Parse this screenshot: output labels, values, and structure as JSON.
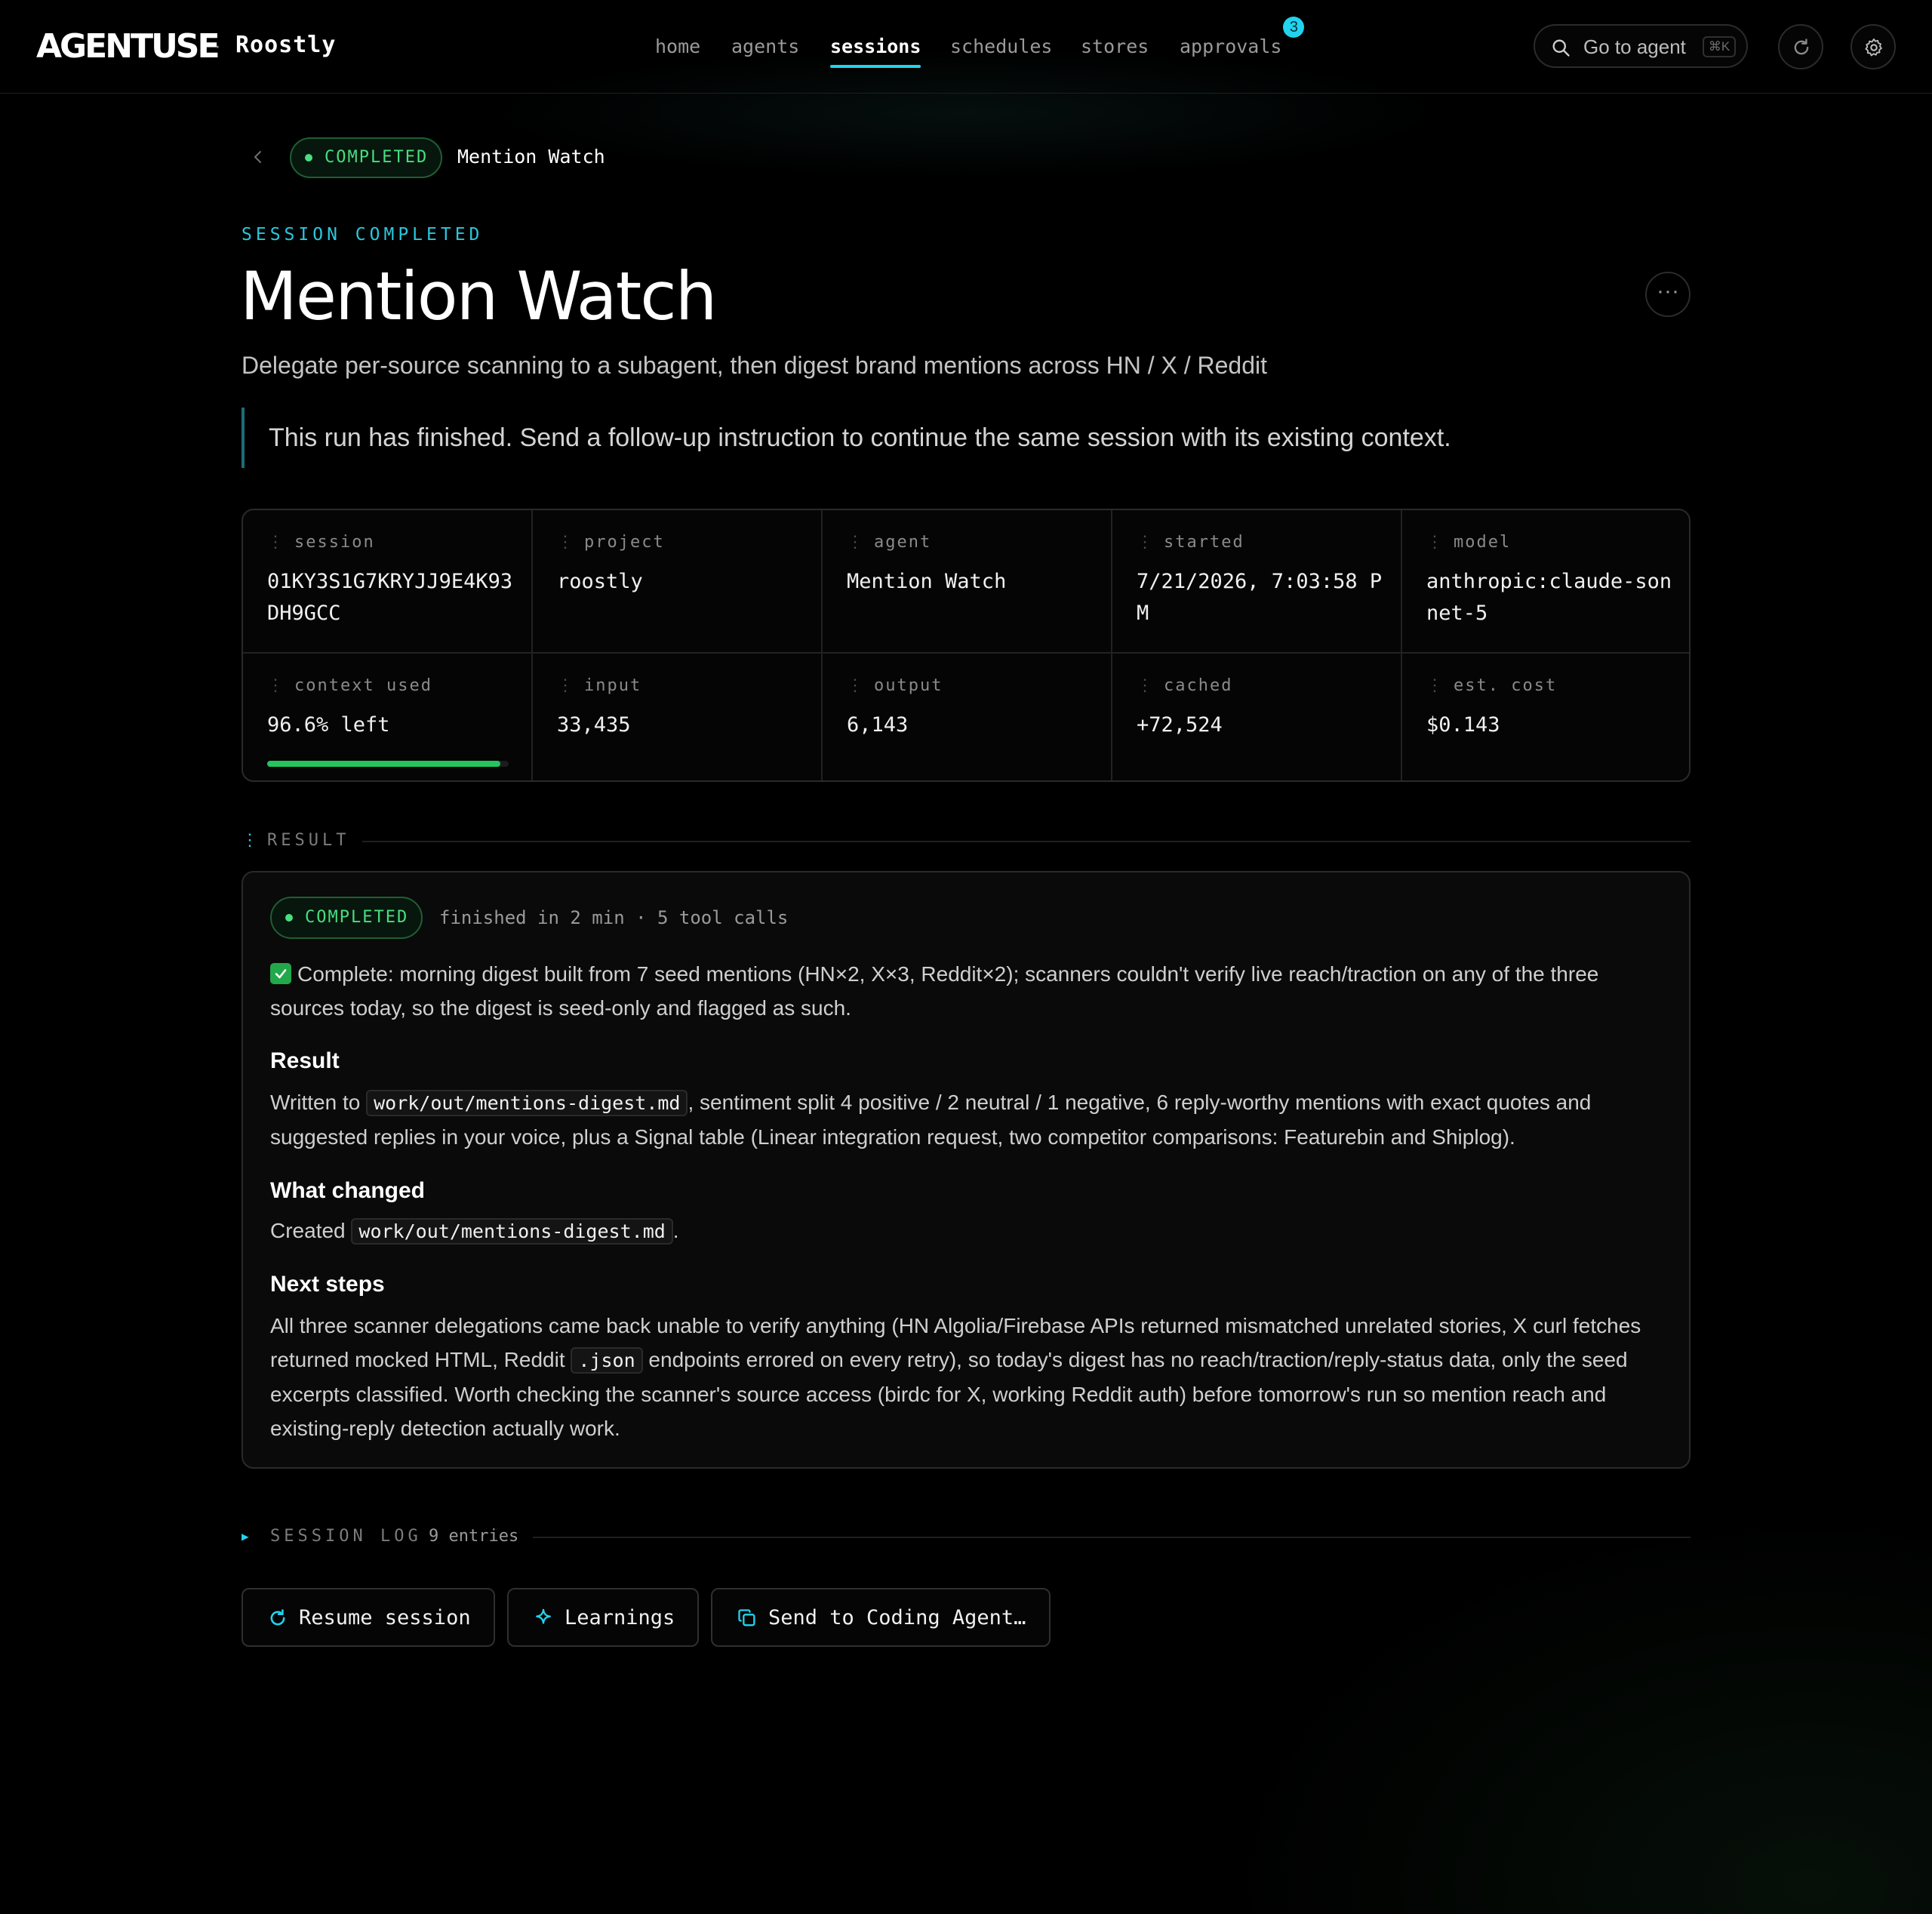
{
  "app": {
    "logo": "AGENTUSE",
    "separator": "·",
    "workspace": "Roostly"
  },
  "nav": {
    "items": [
      {
        "label": "home"
      },
      {
        "label": "agents"
      },
      {
        "label": "sessions",
        "active": true
      },
      {
        "label": "schedules"
      },
      {
        "label": "stores"
      },
      {
        "label": "approvals",
        "badge": "3"
      }
    ]
  },
  "search": {
    "label": "Go to agent",
    "shortcut": "⌘K",
    "icon": "search-icon"
  },
  "header_icons": [
    "refresh-icon",
    "gear-icon"
  ],
  "breadcrumb": {
    "status": "COMPLETED",
    "title": "Mention Watch"
  },
  "page": {
    "eyebrow": "SESSION COMPLETED",
    "title": "Mention Watch",
    "subtitle": "Delegate per-source scanning to a subagent, then digest brand mentions across HN / X / Reddit",
    "notice": "This run has finished. Send a follow-up instruction to continue the same session with its existing context.",
    "more_label": "···"
  },
  "stats": {
    "session": {
      "label": "session",
      "value": "01KY3S1G7KRYJJ9E4K93DH9GCC"
    },
    "project": {
      "label": "project",
      "value": "roostly"
    },
    "agent": {
      "label": "agent",
      "value": "Mention Watch"
    },
    "started": {
      "label": "started",
      "value": "7/21/2026, 7:03:58 PM"
    },
    "model": {
      "label": "model",
      "value": "anthropic:claude-sonnet-5"
    },
    "context": {
      "label": "context used",
      "value": "96.6% left",
      "fill_fraction": 0.966
    },
    "input": {
      "label": "input",
      "value": "33,435"
    },
    "output": {
      "label": "output",
      "value": "6,143"
    },
    "cached": {
      "label": "cached",
      "value": "+72,524"
    },
    "cost": {
      "label": "est. cost",
      "value": "$0.143"
    }
  },
  "result": {
    "section_label": "RESULT",
    "status": "COMPLETED",
    "meta": "finished in 2 min · 5 tool calls",
    "summary": "Complete: morning digest built from 7 seed mentions (HN×2, X×3, Reddit×2); scanners couldn't verify live reach/traction on any of the three sources today, so the digest is seed-only and flagged as such.",
    "result_heading": "Result",
    "result_text_before": "Written to ",
    "result_code": "work/out/mentions-digest.md",
    "result_text_after": ", sentiment split 4 positive / 2 neutral / 1 negative, 6 reply-worthy mentions with exact quotes and suggested replies in your voice, plus a Signal table (Linear integration request, two competitor comparisons: Featurebin and Shiplog).",
    "changed_heading": "What changed",
    "changed_before": "Created ",
    "changed_code": "work/out/mentions-digest.md",
    "changed_after": ".",
    "next_heading": "Next steps",
    "next_before": "All three scanner delegations came back unable to verify anything (HN Algolia/Firebase APIs returned mismatched unrelated stories, X curl fetches returned mocked HTML, Reddit ",
    "next_code": ".json",
    "next_after": " endpoints errored on every retry), so today's digest has no reach/traction/reply-status data, only the seed excerpts classified. Worth checking the scanner's source access (birdc for X, working Reddit auth) before tomorrow's run so mention reach and existing-reply detection actually work."
  },
  "session_log": {
    "label": "SESSION LOG",
    "count": "9 entries"
  },
  "actions": {
    "resume": "Resume session",
    "learnings": "Learnings",
    "send": "Send to Coding Agent…"
  },
  "colors": {
    "accent": "#22d3ee",
    "success": "#4ade80",
    "background": "#000000"
  }
}
